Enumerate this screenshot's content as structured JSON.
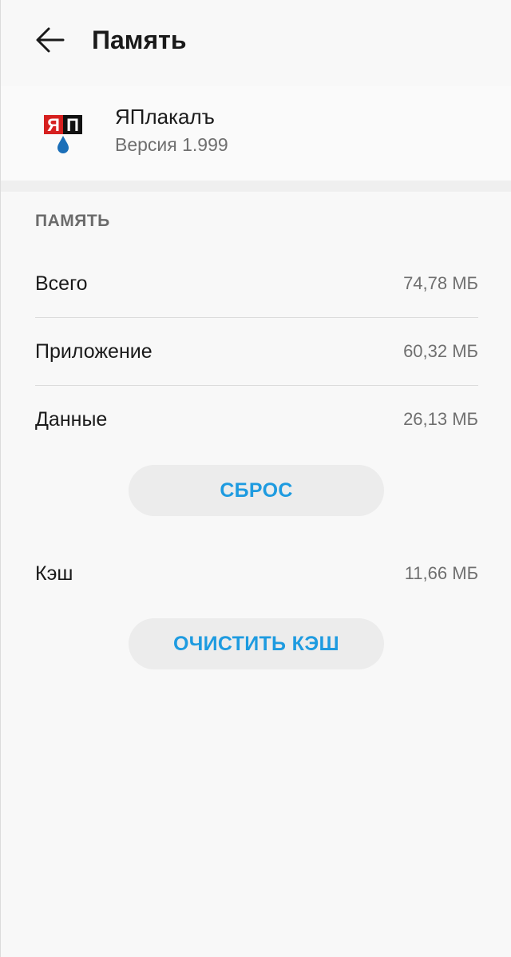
{
  "toolbar": {
    "title": "Память",
    "back_icon": "arrow-left-icon"
  },
  "app": {
    "name": "ЯПлакалъ",
    "version": "Версия 1.999",
    "logo_text": "ЯП",
    "logo_colors": {
      "red": "#d6201f",
      "black": "#111111",
      "drop": "#1b6fb8"
    }
  },
  "storage": {
    "header": "ПАМЯТЬ",
    "rows": [
      {
        "label": "Всего",
        "value": "74,78 МБ"
      },
      {
        "label": "Приложение",
        "value": "60,32 МБ"
      },
      {
        "label": "Данные",
        "value": "26,13 МБ"
      }
    ],
    "reset_button": "СБРОС",
    "cache": {
      "label": "Кэш",
      "value": "11,66 МБ"
    },
    "clear_cache_button": "ОЧИСТИТЬ КЭШ"
  },
  "colors": {
    "accent": "#1e9be0",
    "background": "#f8f8f8",
    "button_bg": "#ececec"
  }
}
